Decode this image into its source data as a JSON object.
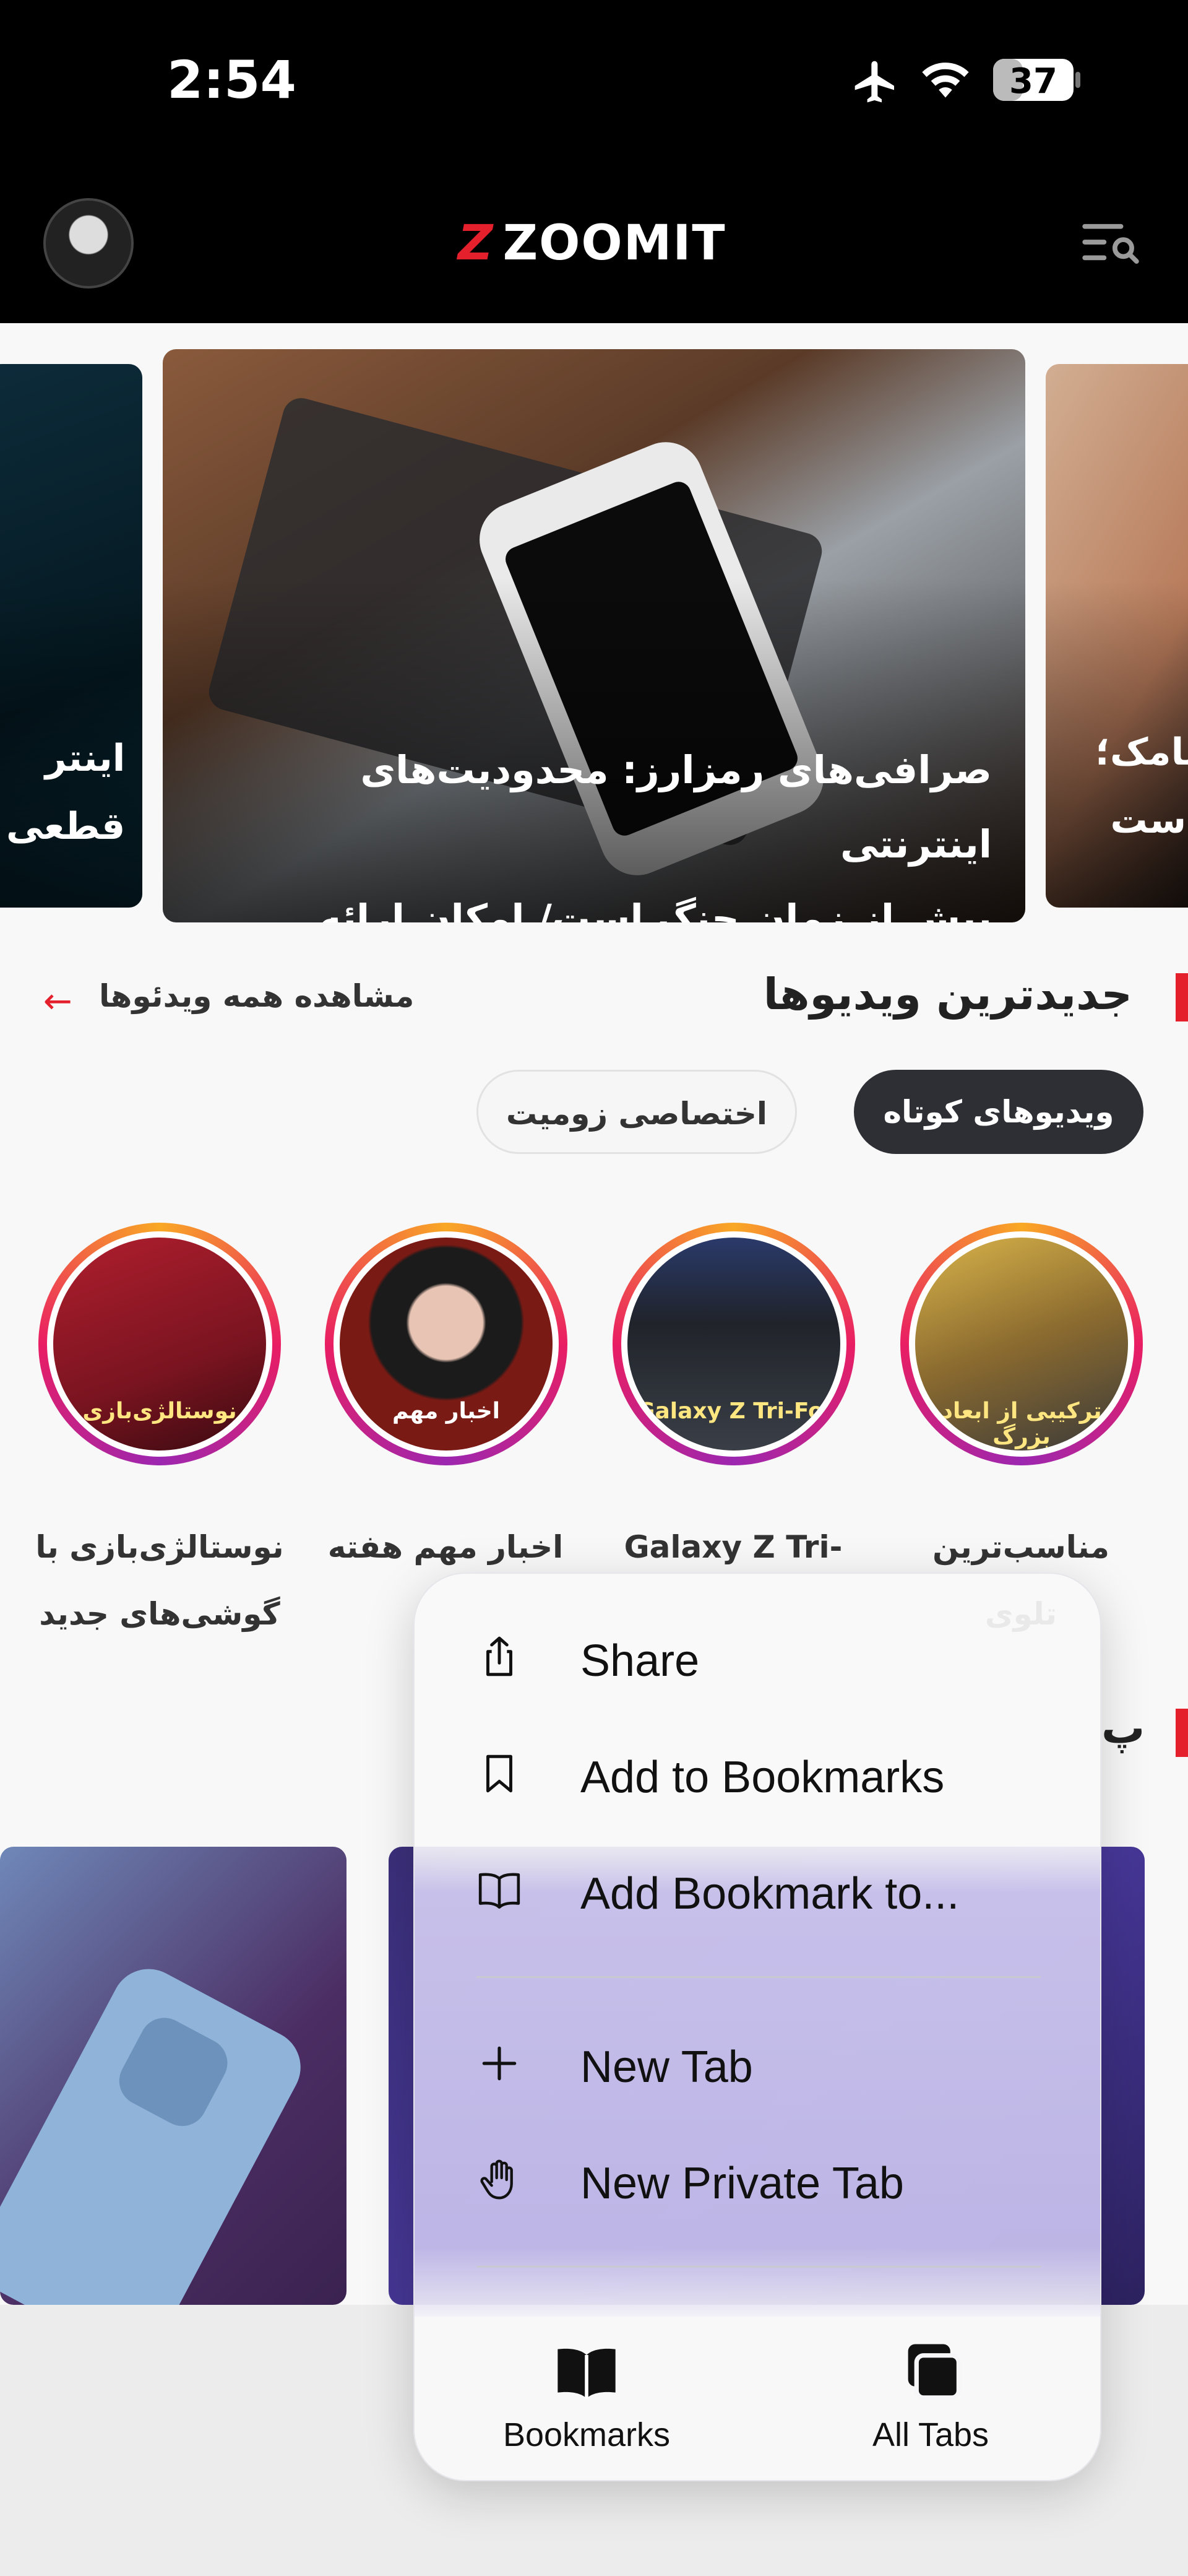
{
  "status_bar": {
    "time": "2:54",
    "battery": "37",
    "battery_level": 0.37
  },
  "header": {
    "logo_text": "ZOOMIT",
    "brand_color": "#e3202b"
  },
  "hero": {
    "main_title_line1": "صرافی‌های رمزارز: محدودیت‌های اینترنتی",
    "main_title_line2": "بیش از زمان جنگ است/ امکان ارائه خدم...",
    "left_card_line1": "اینتر",
    "left_card_line2": "قطعی",
    "right_card_line1": "یامک؛",
    "right_card_line2": "است"
  },
  "videos": {
    "title": "جدیدترین ویدیوها",
    "see_all": "مشاهده همه ویدئوها",
    "tabs": [
      "ویدیوهای کوتاه",
      "اختصاصی زومیت"
    ],
    "stories": [
      {
        "label_line1": "مناسب‌ترین",
        "label_line2": "تلوی",
        "cover_text": "ترکیبی از ابعاد بزرگ"
      },
      {
        "label_line1": "Galaxy Z Tri-",
        "label_line2": "",
        "cover_text": "Galaxy Z Tri-Fol"
      },
      {
        "label_line1": "اخبار مهم هفته",
        "label_line2": "",
        "cover_text": "اخبار مهم"
      },
      {
        "label_line1": "نوستالژی‌بازی با",
        "label_line2": "گوشی‌های جدید",
        "cover_text": "نوستالژی‌بازی"
      }
    ]
  },
  "section2": {
    "title_fragment": "پ"
  },
  "context_menu": {
    "items": [
      {
        "label": "Share",
        "icon": "share-icon"
      },
      {
        "label": "Add to Bookmarks",
        "icon": "bookmark-icon"
      },
      {
        "label": "Add Bookmark to...",
        "icon": "open-book-icon"
      },
      {
        "label": "New Tab",
        "icon": "plus-icon"
      },
      {
        "label": "New Private Tab",
        "icon": "hand-icon"
      }
    ],
    "bottom": [
      {
        "label": "Bookmarks",
        "icon": "bookmarks-book-icon"
      },
      {
        "label": "All Tabs",
        "icon": "tabs-icon"
      }
    ]
  }
}
